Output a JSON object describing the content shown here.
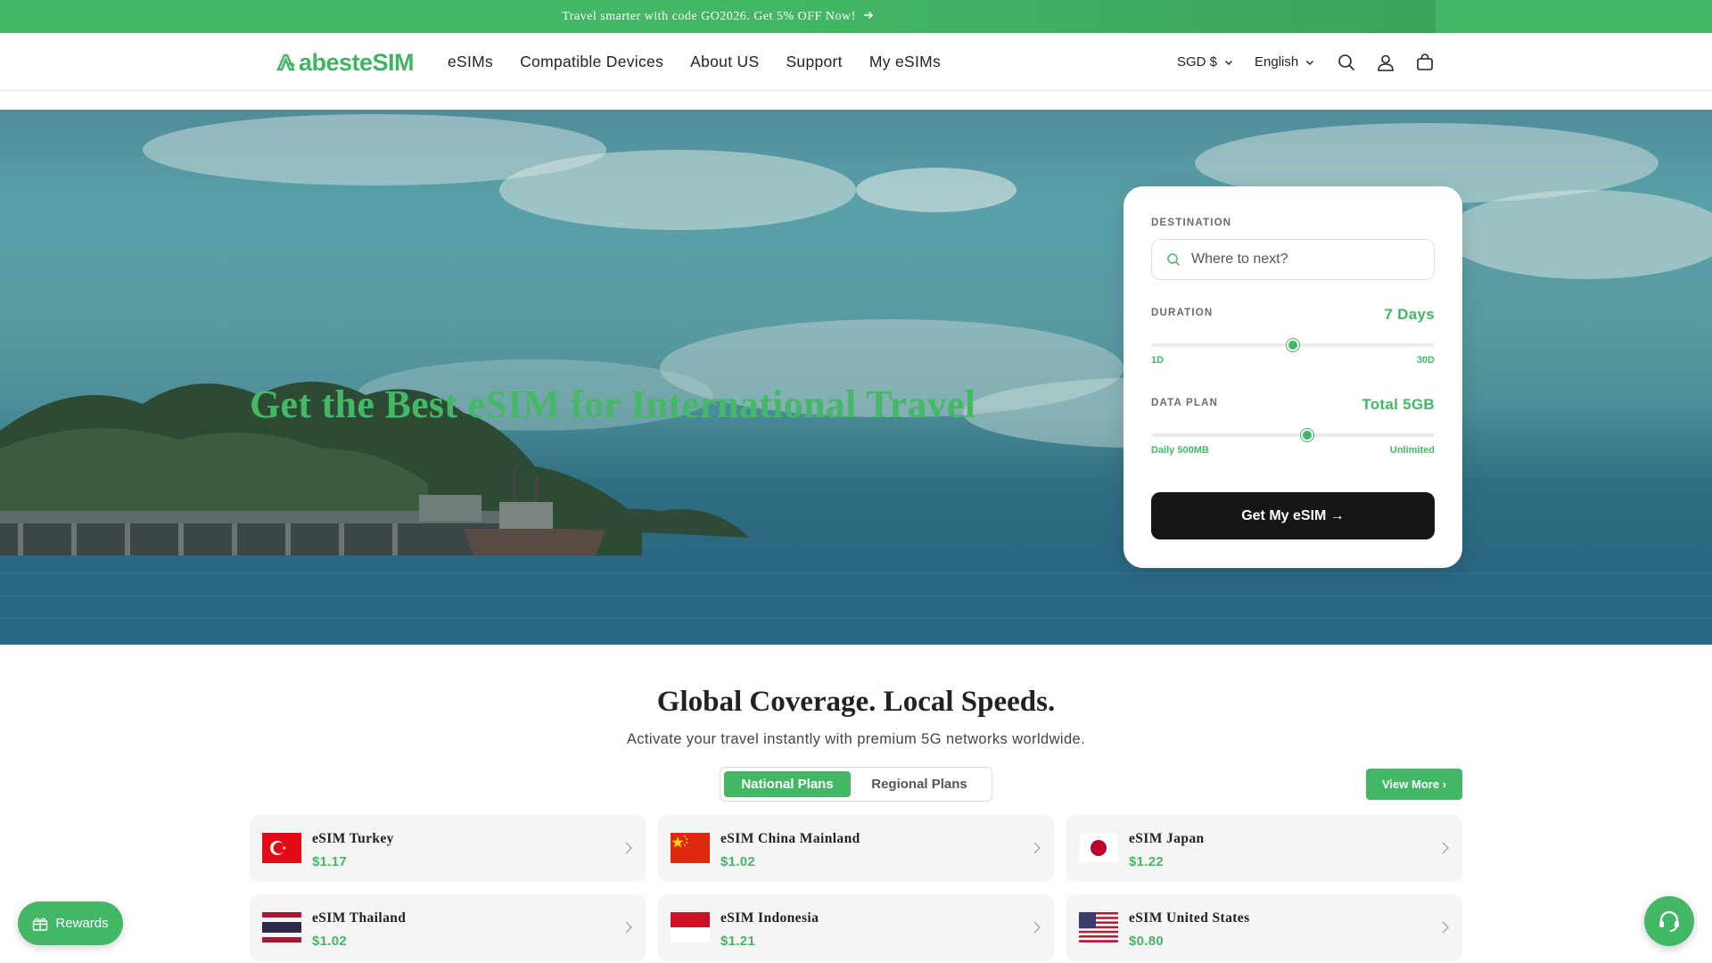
{
  "announcement": {
    "text": "Travel smarter with code GO2026. Get 5% OFF Now!"
  },
  "header": {
    "logo_text": "abesteSIM",
    "nav": [
      "eSIMs",
      "Compatible Devices",
      "About US",
      "Support",
      "My eSIMs"
    ],
    "currency": "SGD $",
    "language": "English"
  },
  "hero": {
    "title": "Get the Best eSIM for International Travel"
  },
  "search_card": {
    "destination_label": "DESTINATION",
    "destination_placeholder": "Where to next?",
    "duration_label": "DURATION",
    "duration_value": "7 Days",
    "duration_min": "1D",
    "duration_max": "30D",
    "duration_fraction": 0.5,
    "data_label": "DATA PLAN",
    "data_value": "Total 5GB",
    "data_min": "Daily 500MB",
    "data_max": "Unlimited",
    "data_fraction": 0.55,
    "cta": "Get My eSIM →"
  },
  "coverage": {
    "title": "Global Coverage. Local Speeds.",
    "subtitle": "Activate your travel instantly with premium 5G networks worldwide.",
    "tabs": [
      "National Plans",
      "Regional Plans"
    ],
    "view_more": "View More ›",
    "plans": [
      {
        "name": "eSIM Turkey",
        "price": "$1.17",
        "flag": "turkey-flag"
      },
      {
        "name": "eSIM China Mainland",
        "price": "$1.02",
        "flag": "china-flag"
      },
      {
        "name": "eSIM Japan",
        "price": "$1.22",
        "flag": "japan-flag"
      },
      {
        "name": "eSIM Thailand",
        "price": "$1.02",
        "flag": "thailand-flag"
      },
      {
        "name": "eSIM Indonesia",
        "price": "$1.21",
        "flag": "indonesia-flag"
      },
      {
        "name": "eSIM United States",
        "price": "$0.80",
        "flag": "usa-flag"
      }
    ]
  },
  "floating": {
    "rewards": "Rewards"
  },
  "colors": {
    "brand_green": "#43b766",
    "cta_dark": "#161616"
  }
}
